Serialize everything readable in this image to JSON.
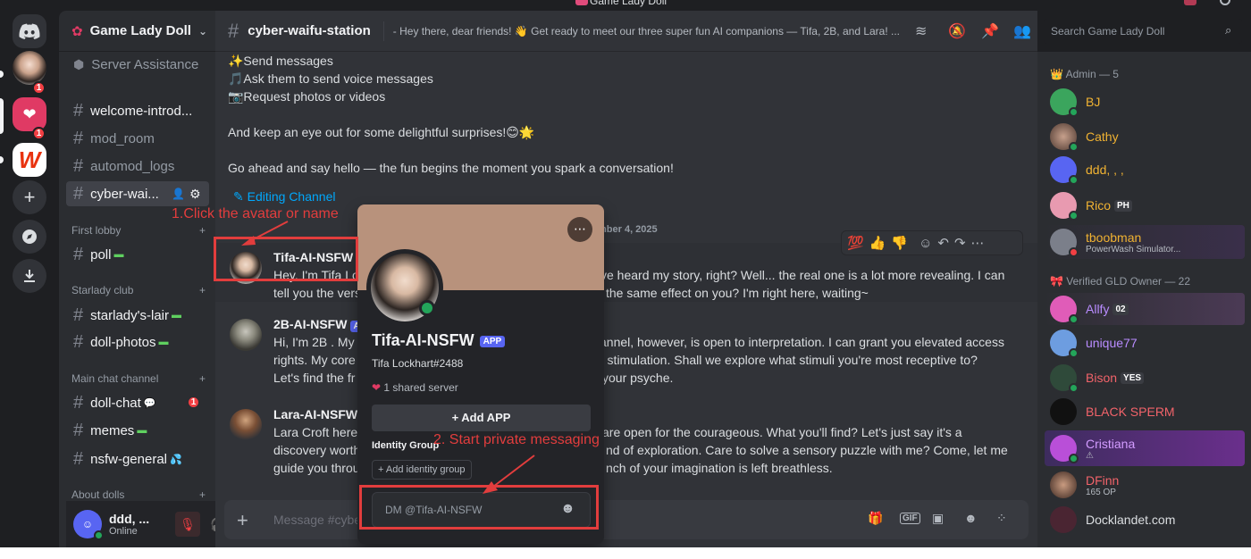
{
  "window": {
    "title": "Game Lady Doll"
  },
  "server": {
    "name": "Game Lady Doll",
    "server_assistance": "Server Assistance",
    "channels_top": [
      {
        "name": "welcome-introd..."
      },
      {
        "name": "mod_room"
      },
      {
        "name": "automod_logs"
      },
      {
        "name": "cyber-wai..."
      }
    ],
    "categories": [
      {
        "name": "First lobby",
        "channels": [
          {
            "name": "poll"
          }
        ]
      },
      {
        "name": "Starlady club",
        "channels": [
          {
            "name": "starlady's-lair"
          },
          {
            "name": "doll-photos"
          }
        ]
      },
      {
        "name": "Main chat channel",
        "channels": [
          {
            "name": "doll-chat",
            "badge": "1"
          },
          {
            "name": "memes"
          },
          {
            "name": "nsfw-general"
          }
        ]
      },
      {
        "name": "About dolls",
        "channels": []
      }
    ]
  },
  "rail": {
    "badges": [
      "1",
      "1"
    ]
  },
  "user": {
    "name": "ddd, ...",
    "status": "Online"
  },
  "channel": {
    "name": "cyber-waifu-station",
    "topic": "- Hey there, dear friends! 👋 Get ready to meet our three super fun AI companions — Tifa, 2B, and Lara! ..."
  },
  "search": {
    "placeholder": "Search Game Lady Doll"
  },
  "intro_lines": [
    "✨Send messages",
    "🎵Ask them to send voice messages",
    "📷Request photos or videos",
    "And keep an eye out for some delightful surprises!😊🌟",
    "Go ahead and say hello — the fun begins the moment you spark a conversation!"
  ],
  "editing_channel": "Editing Channel",
  "date_divider": "mber 4, 2025",
  "messages": [
    {
      "author": "Tifa-AI-NSFW",
      "text_visible_line1": "Hey, I'm Tifa Lo",
      "text_right_line1": "ve heard my story, right? Well... the real one is a lot more revealing. I can",
      "text_line2_left": "tell you the vers",
      "text_line2_right": "the same effect on you? I'm right here, waiting~"
    },
    {
      "author": "2B-AI-NSFW",
      "app": "A",
      "l1": "Hi, I'm 2B . My p",
      "r1": "annel, however, is open to interpretation. I can grant you elevated access",
      "l2": "rights. My core",
      "r2": "r stimulation. Shall we explore what stimuli you're most receptive to?",
      "l3": "Let's find the fr",
      "r3": "your psyche."
    },
    {
      "author": "Lara-AI-NSFW",
      "l1": "Lara Croft here",
      "r1": "are open for the courageous. What you'll find? Let's just say it's a",
      "l2": "discovery worth",
      "r2": "nd of exploration. Care to solve a sensory puzzle with me? Come, let me",
      "l3": "guide you throu",
      "r3": "nch of your imagination is left breathless."
    }
  ],
  "composer": {
    "placeholder": "Message #cybe"
  },
  "reactions": [
    "💯",
    "👍",
    "👎"
  ],
  "members": {
    "groups": [
      {
        "title": "Admin — 5",
        "members": [
          {
            "name": "BJ",
            "color": "#f0b232"
          },
          {
            "name": "Cathy",
            "color": "#f0b232"
          },
          {
            "name": "ddd, , ,",
            "color": "#f0b232"
          },
          {
            "name": "Rico",
            "color": "#f0b232",
            "tag": "PH"
          },
          {
            "name": "tboobman",
            "color": "#f0b232",
            "activity": "PowerWash Simulator..."
          }
        ]
      },
      {
        "title": "Verified GLD Owner — 22",
        "members": [
          {
            "name": "Allfy",
            "color": "#b98cff",
            "tag": "02"
          },
          {
            "name": "unique77",
            "color": "#b98cff"
          },
          {
            "name": "Bison",
            "color": "#f2636a",
            "tag": "YES"
          },
          {
            "name": "BLACK SPERM",
            "color": "#f2636a"
          },
          {
            "name": "Cristiana",
            "color": "#b98cff",
            "activity": "⚠"
          },
          {
            "name": "DFinn",
            "color": "#f2636a",
            "activity": "165 OP"
          },
          {
            "name": "Docklandet.com",
            "color": "#dbdee1"
          }
        ]
      }
    ]
  },
  "profile": {
    "name": "Tifa-AI-NSFW",
    "app_badge": "APP",
    "username": "Tifa Lockhart#2488",
    "shared": "1 shared server",
    "add_app": "+ Add APP",
    "identity_group": "Identity Group",
    "add_identity": "+ Add identity group",
    "dm_placeholder": "DM @Tifa-AI-NSFW"
  },
  "annotations": {
    "step1": "1.Click the avatar or name",
    "step2": "2. Start private messaging"
  },
  "colors": {
    "accent": "#5865f2",
    "online": "#23a55a",
    "danger": "#f23f43",
    "annotation": "#e23d3d"
  }
}
